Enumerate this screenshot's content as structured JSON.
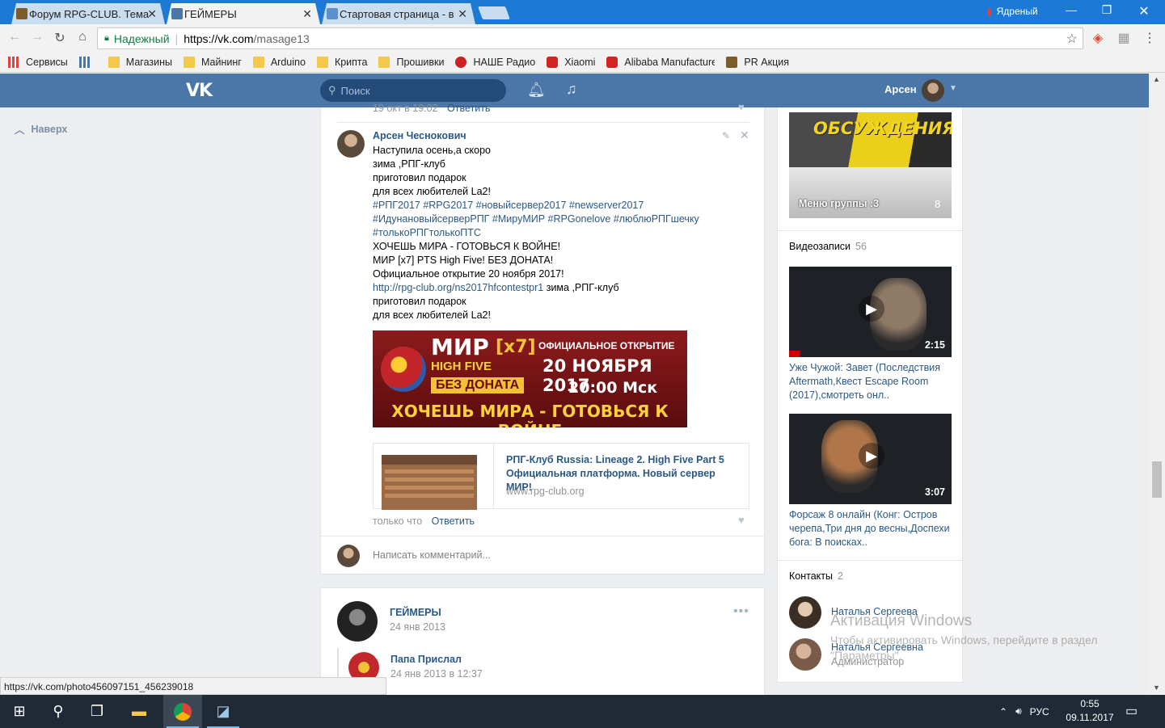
{
  "browser": {
    "tabs": [
      {
        "title": "Форум RPG-CLUB. Тема",
        "close": "✕"
      },
      {
        "title": "ГЕЙМЕРЫ",
        "close": "✕"
      },
      {
        "title": "Стартовая страница - в",
        "close": "✕"
      }
    ],
    "profile_name": "Ядреный",
    "secure_label": "Надежный",
    "url_host": "https://vk.com",
    "url_path": "/masage13",
    "bookmarks": [
      "Сервисы",
      "Магазины",
      "Майнинг",
      "Arduino",
      "Крипта",
      "Прошивки",
      "НАШЕ Радио",
      "Xiaomi",
      "Alibaba Manufacturer",
      "PR Акция"
    ]
  },
  "vk": {
    "search_placeholder": "Поиск",
    "user_name": "Арсен",
    "up_label": "Наверх"
  },
  "post": {
    "prev_comment_time": "19 окт в 19:02",
    "reply_label": "Ответить",
    "comment": {
      "author": "Арсен Чеснокович",
      "lines": [
        "Наступила осень,а скоро",
        "зима ,РПГ-клуб",
        "приготовил подарок",
        "для всех любителей La2!"
      ],
      "hashtags": [
        "#РПГ2017 #RPG2017 #новыйсервер2017 #newserver2017",
        "#ИдунановыйсерверРПГ #МируМИР #RPGonelove #люблюРПГшечку",
        "#толькоРПГтолькоПТС"
      ],
      "lines2": [
        "ХОЧЕШЬ МИРА - ГОТОВЬСЯ К ВОЙНЕ!",
        "МИР [x7] PTS High Five! БЕЗ ДОНАТА!",
        "Официальное открытие 20 ноября 2017!"
      ],
      "link_text": "http://rpg-club.org/ns2017hfcontestpr1",
      "link_after": " зима ,РПГ-клуб",
      "lines3": [
        "приготовил подарок",
        "для всех любителей La2!"
      ],
      "banner": {
        "mir": "МИР",
        "x7": "[x7]",
        "high_five": "HIGH FIVE",
        "no_donate": "БЕЗ ДОНАТА",
        "opening": "ОФИЦИАЛЬНОЕ ОТКРЫТИЕ",
        "date": "20 НОЯБРЯ 2017",
        "time": "20:00 Мск",
        "war": "ХОЧЕШЬ МИРА - ГОТОВЬСЯ К ВОЙНЕ"
      },
      "link_card": {
        "title": "РПГ-Клуб Russia: Lineage 2. High Five Part 5 Официальная платформа. Новый сервер МИР!",
        "url": "www.rpg-club.org"
      },
      "time": "только что"
    },
    "write_placeholder": "Написать комментарий..."
  },
  "post2": {
    "author": "ГЕЙМЕРЫ",
    "date": "24 янв 2013",
    "more": "•••",
    "repost_author": "Папа Прислал",
    "repost_date": "24 янв 2013 в 12:37"
  },
  "sidebar": {
    "discussion_banner": "ОБСУЖДЕНИЯ",
    "discussion_label": "Меню группы :3",
    "discussion_count": "8",
    "videos_title": "Видеозаписи",
    "videos_count": "56",
    "videos": [
      {
        "duration": "2:15",
        "title": "Уже Чужой: Завет (Последствия Aftermath,Квест Escape Room (2017),смотреть онл.."
      },
      {
        "duration": "3:07",
        "title": "Форсаж 8 онлайн (Конг: Остров черепа,Три дня до весны,Доспехи бога: В поисках.."
      }
    ],
    "contacts_title": "Контакты",
    "contacts_count": "2",
    "contacts": [
      {
        "name": "Наталья Сергеева",
        "role": ""
      },
      {
        "name": "Наталья Сергеевна",
        "role": "Администратор"
      }
    ]
  },
  "status_url": "https://vk.com/photo456097151_456239018",
  "watermark": {
    "title": "Активация Windows",
    "text": "Чтобы активировать Windows, перейдите в раздел \"Параметры\"."
  },
  "taskbar": {
    "lang": "РУС",
    "time": "0:55",
    "date": "09.11.2017"
  },
  "colors": {
    "vk_blue": "#4a76a8",
    "link": "#2a5885",
    "chrome_title": "#1c7ad6"
  }
}
